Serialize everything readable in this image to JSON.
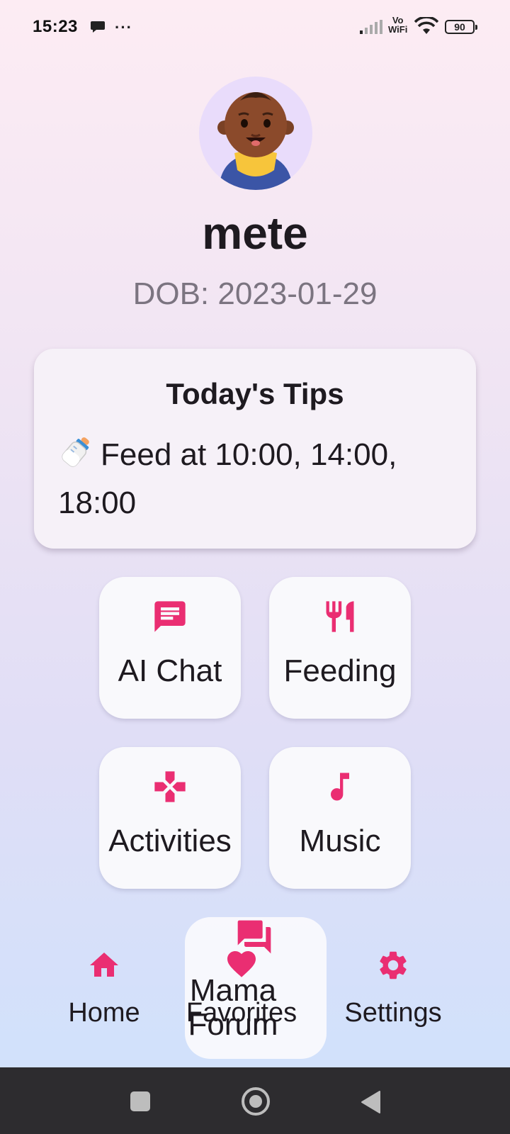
{
  "status_bar": {
    "time": "15:23",
    "more": "···",
    "vo_label": "Vo",
    "wifi_label": "WiFi",
    "battery": "90"
  },
  "profile": {
    "name": "mete",
    "dob": "DOB: 2023-01-29",
    "avatar_icon": "baby-avatar-icon"
  },
  "tips": {
    "title": "Today's Tips",
    "text": "Feed at 10:00, 14:00, 18:00",
    "icon": "baby-bottle-icon"
  },
  "features": [
    {
      "label": "AI Chat",
      "icon": "chat-icon"
    },
    {
      "label": "Feeding",
      "icon": "fork-knife-icon"
    },
    {
      "label": "Activities",
      "icon": "gamepad-icon"
    },
    {
      "label": "Music",
      "icon": "music-note-icon"
    }
  ],
  "mama_forum": {
    "label": "Mama Forum",
    "icon": "forum-icon"
  },
  "bottom_nav": {
    "items": [
      {
        "label": "Home",
        "icon": "home-icon"
      },
      {
        "label": "Favorites",
        "icon": "heart-icon"
      },
      {
        "label": "Settings",
        "icon": "gear-icon"
      }
    ]
  },
  "colors": {
    "accent": "#ea2e72",
    "tile_bg": "#f9f9fc",
    "card_bg": "#f6f1f8",
    "system_nav_bg": "#2d2c2f"
  }
}
